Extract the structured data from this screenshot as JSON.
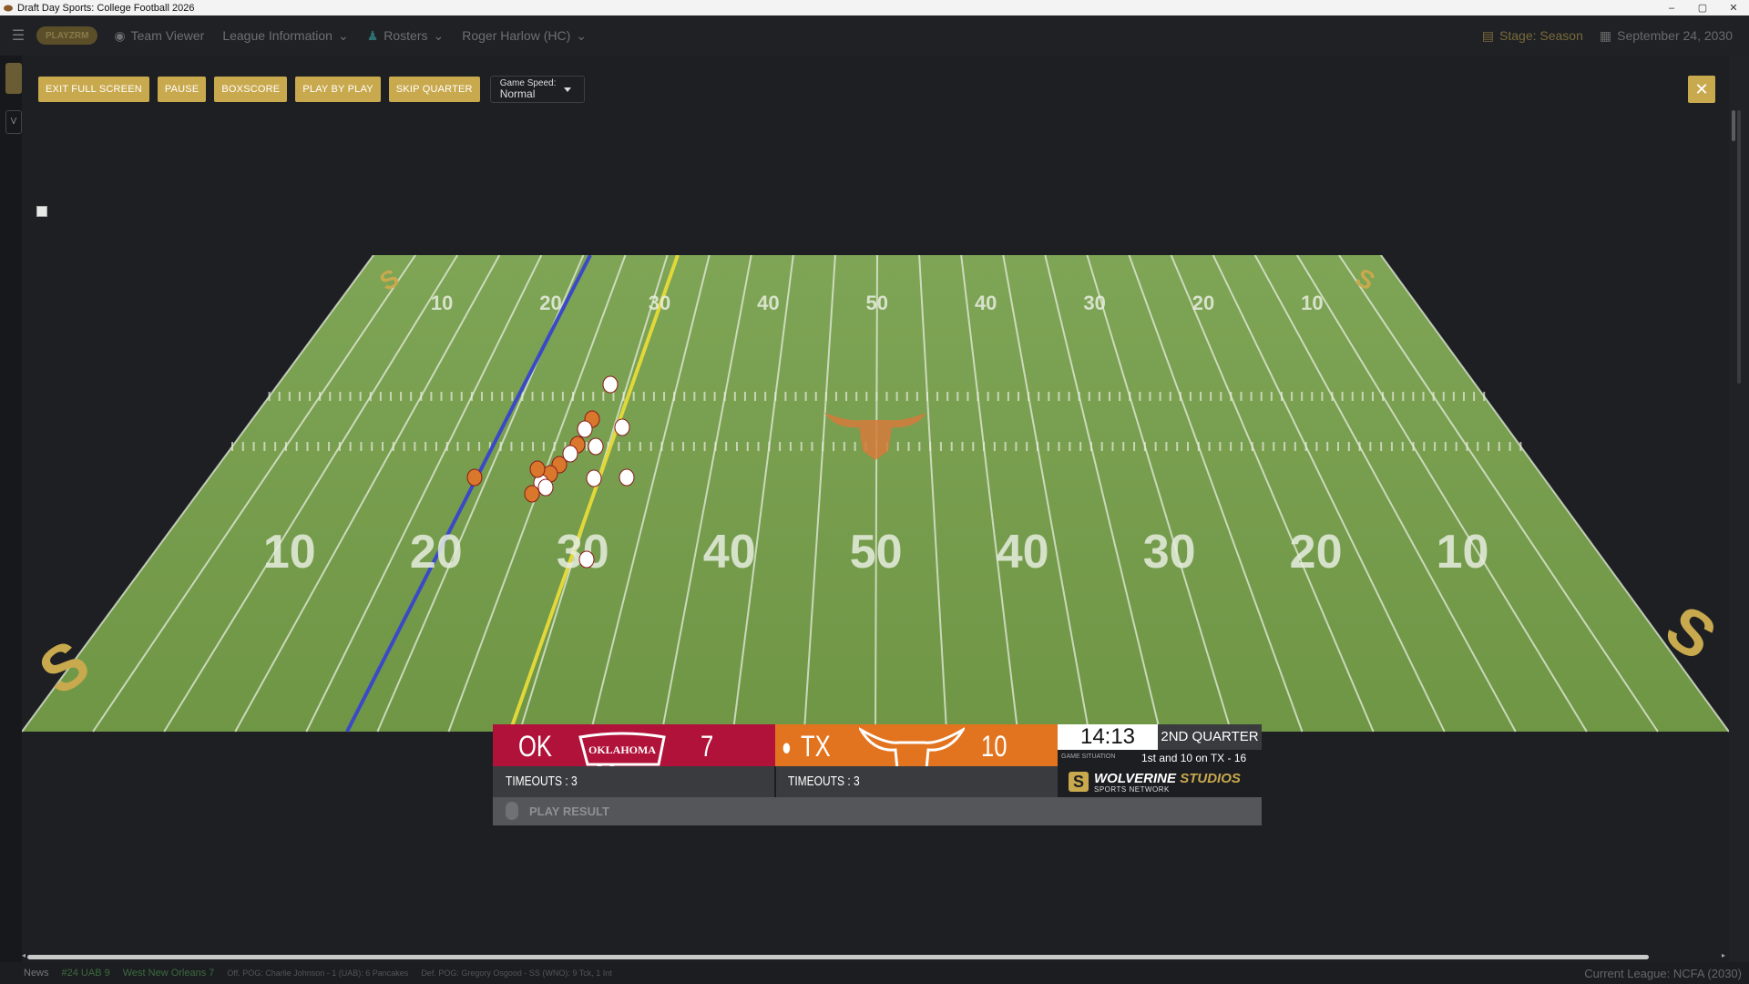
{
  "window": {
    "title": "Draft Day Sports: College Football 2026",
    "controls": [
      "–",
      "▢",
      "✕"
    ]
  },
  "nav": {
    "logo": "PLAYZRM",
    "items": [
      "Team Viewer",
      "League Information",
      "Rosters",
      "Roger Harlow (HC)"
    ],
    "stage": "Stage: Season",
    "date": "September 24, 2030"
  },
  "controls": {
    "exit_full_screen": "EXIT FULL SCREEN",
    "pause": "PAUSE",
    "boxscore": "BOXSCORE",
    "play_by_play": "PLAY BY PLAY",
    "skip_quarter": "SKIP QUARTER",
    "game_speed_label": "Game Speed:",
    "game_speed_value": "Normal",
    "close": "✕"
  },
  "field": {
    "far_numbers": [
      "10",
      "20",
      "30",
      "40",
      "50",
      "40",
      "30",
      "20",
      "10"
    ],
    "near_numbers": [
      "10",
      "20",
      "30",
      "40",
      "50",
      "40",
      "30",
      "20",
      "10"
    ],
    "colors": {
      "turf": "#6f9a46",
      "turf_dark": "#5d8a3a",
      "ok_team": "#ffffff",
      "tx_team": "#d9782c",
      "scrimmage": "#3a49c8",
      "first_down": "#e2d83a"
    }
  },
  "scoreboard": {
    "home": {
      "abbr": "OK",
      "logo_text": "OKLAHOMA",
      "score": "7",
      "timeouts": "TIMEOUTS : 3",
      "color": "#b1123a"
    },
    "away": {
      "abbr": "TX",
      "score": "10",
      "timeouts": "TIMEOUTS : 3",
      "color": "#e2731f",
      "possession": true
    },
    "clock": "14:13",
    "quarter": "2ND QUARTER",
    "situation_label": "GAME SITUATION",
    "situation": "1st and 10 on TX - 16",
    "brand_name": "WOLVERINE",
    "brand_name_2": "STUDIOS",
    "brand_sub": "SPORTS NETWORK",
    "play_result": "PLAY RESULT"
  },
  "status": {
    "news": "News",
    "item1": "#24 UAB 9",
    "item2": "West New Orleans 7",
    "pog_off": "Off. POG: Charlie Johnson - 1 (UAB): 6 Pancakes",
    "pog_def": "Def. POG: Gregory Osgood - SS (WNO): 9 Tck, 1 Int",
    "league": "Current League: NCFA (2030)"
  }
}
